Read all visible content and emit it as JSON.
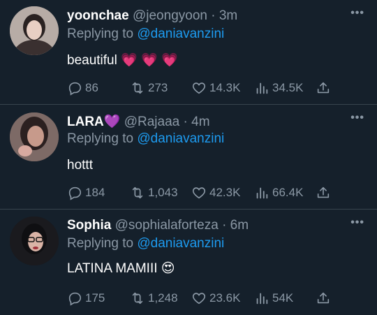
{
  "replying_prefix": "Replying to",
  "more_label": "•••",
  "replies": [
    {
      "name": "yoonchae",
      "badge": "",
      "handle": "@jeongyoon",
      "separator": "·",
      "time": "3m",
      "replying_to": "@daniavanzini",
      "text": "beautiful 💗 💗 💗",
      "stats": {
        "replies": "86",
        "retweets": "273",
        "likes": "14.3K",
        "views": "34.5K"
      }
    },
    {
      "name": "LARA",
      "badge": "💜",
      "handle": "@Rajaaa",
      "separator": "·",
      "time": "4m",
      "replying_to": "@daniavanzini",
      "text": "hottt",
      "stats": {
        "replies": "184",
        "retweets": "1,043",
        "likes": "42.3K",
        "views": "66.4K"
      }
    },
    {
      "name": "Sophia",
      "badge": "",
      "handle": "@sophialaforteza",
      "separator": "·",
      "time": "6m",
      "replying_to": "@daniavanzini",
      "text": "LATINA MAMIII 😍",
      "stats": {
        "replies": "175",
        "retweets": "1,248",
        "likes": "23.6K",
        "views": "54K"
      }
    }
  ],
  "colors": {
    "background": "#15202b",
    "secondary_text": "#8b98a5",
    "link": "#1d9bf0",
    "divider": "#38444d"
  }
}
